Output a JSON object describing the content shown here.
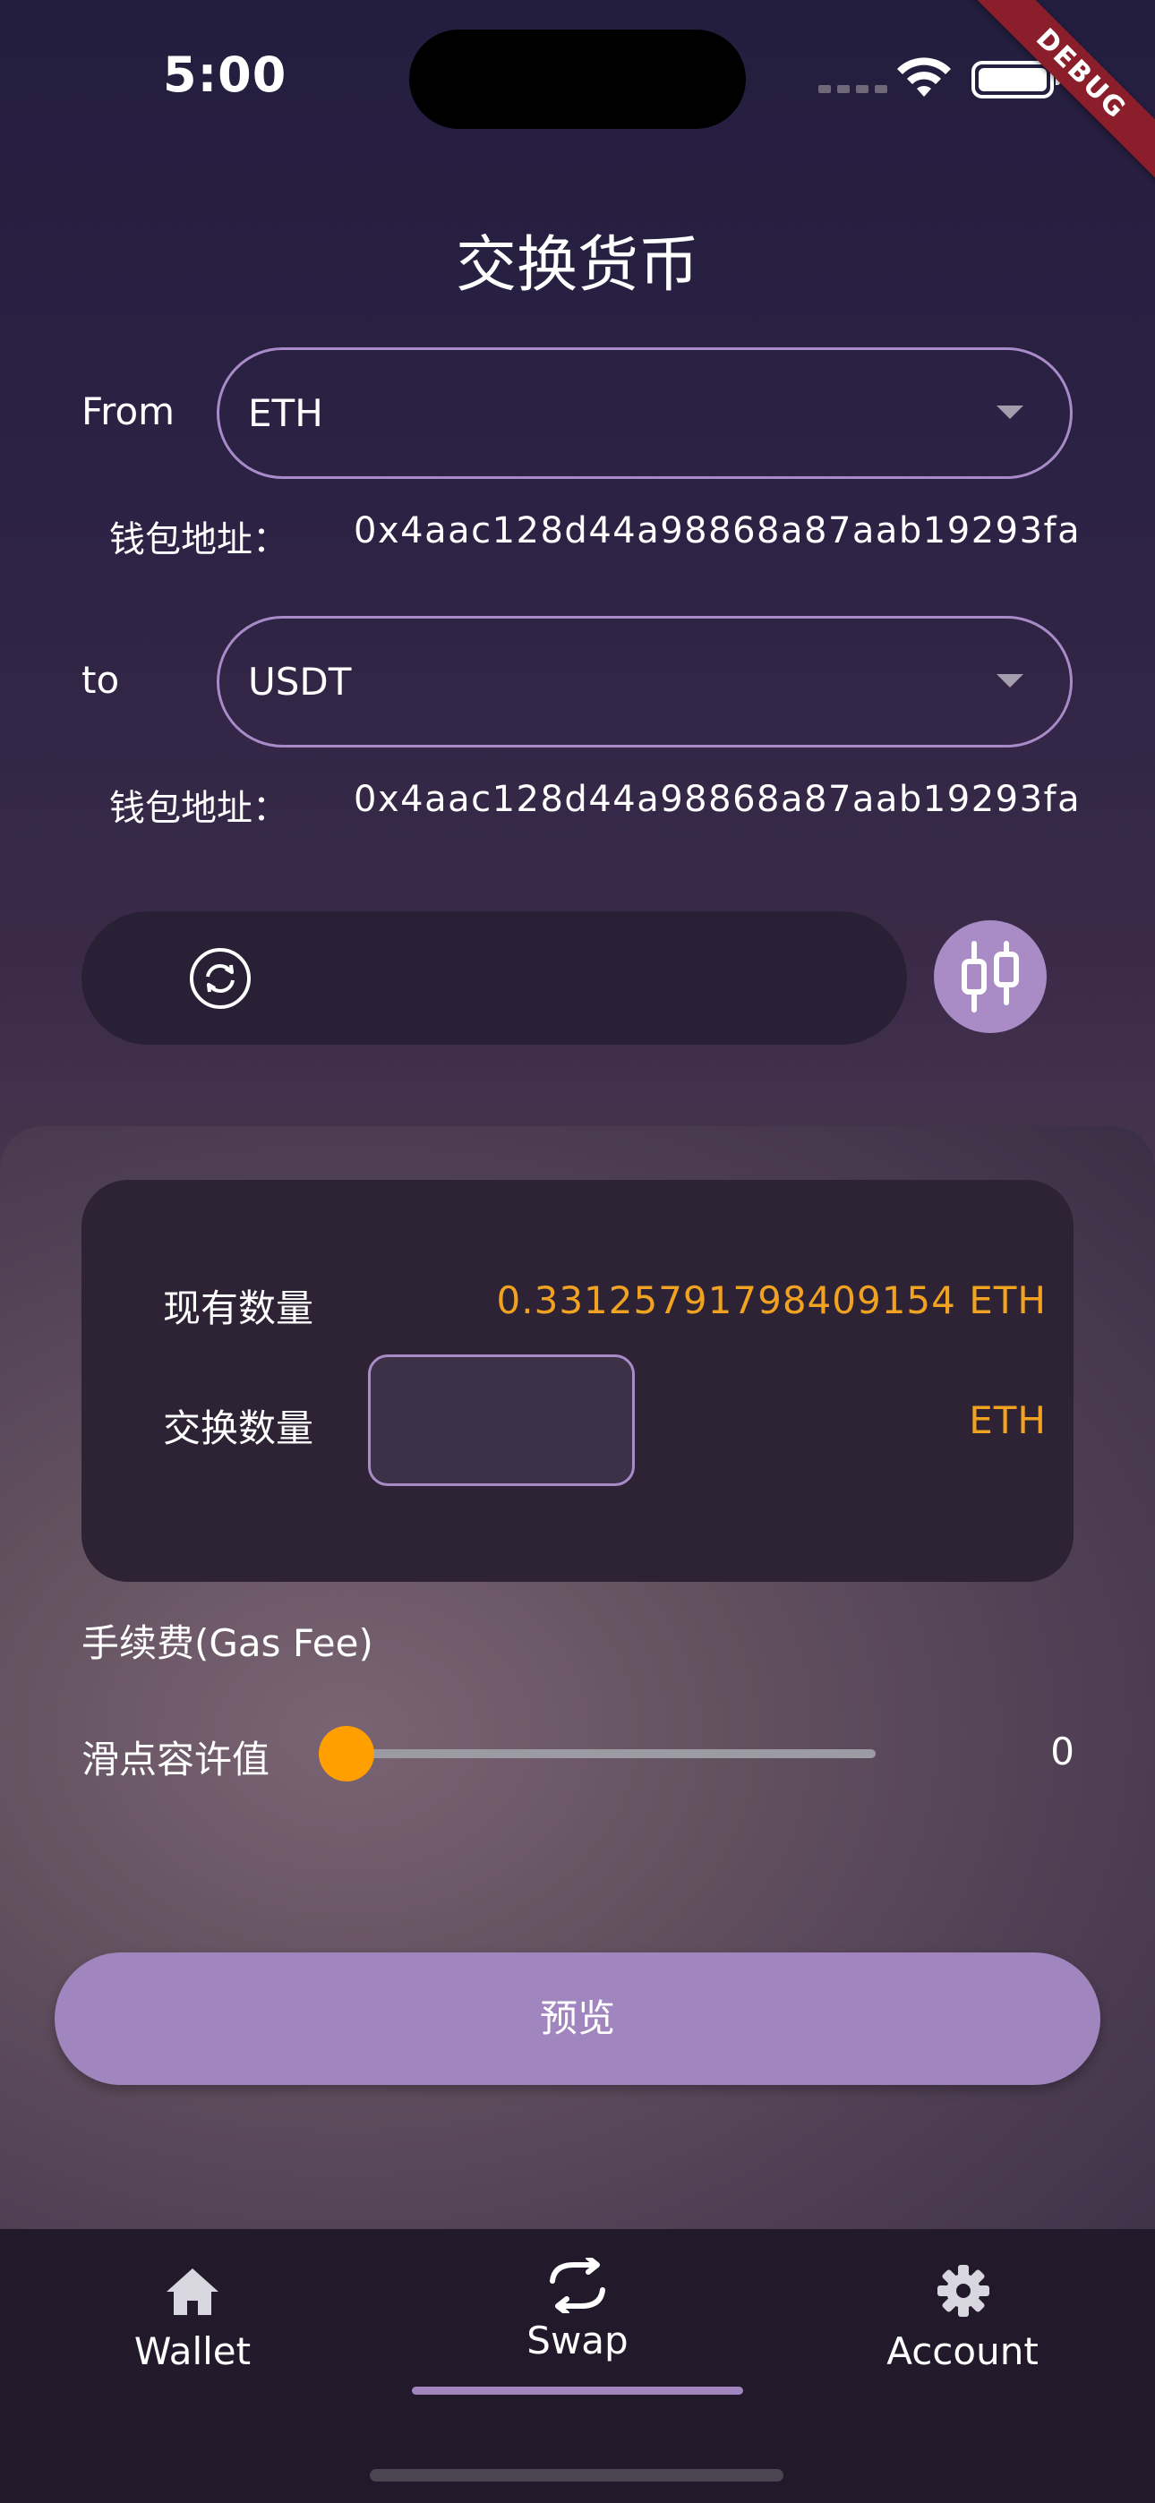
{
  "status_bar": {
    "time": "5:00"
  },
  "debug_banner": "DEBUG",
  "page_title": "交换货币",
  "from_row": {
    "label": "From",
    "selected": "ETH",
    "address_label": "钱包地址：",
    "address": "0x4aac128d44a98868a87aab19293fa"
  },
  "to_row": {
    "label": "to",
    "selected": "USDT",
    "address_label": "钱包地址：",
    "address": "0x4aac128d44a98868a87aab19293fa"
  },
  "card": {
    "balance_label": "现有数量",
    "balance_value": "0.33125791798409154 ETH",
    "swap_label": "交换数量",
    "swap_amount": "",
    "swap_unit": "ETH"
  },
  "gas_fee_label": "手续费(Gas Fee)",
  "slippage": {
    "label": "滑点容许值",
    "value": "0",
    "level": 0
  },
  "preview_button": "预览",
  "nav": {
    "items": [
      {
        "label": "Wallet",
        "icon": "home-icon"
      },
      {
        "label": "Swap",
        "icon": "swap-icon"
      },
      {
        "label": "Account",
        "icon": "gear-icon"
      }
    ],
    "active": 1
  },
  "colors": {
    "accent": "#a185be",
    "amount": "#f2a221",
    "thumb": "#ffa000"
  }
}
